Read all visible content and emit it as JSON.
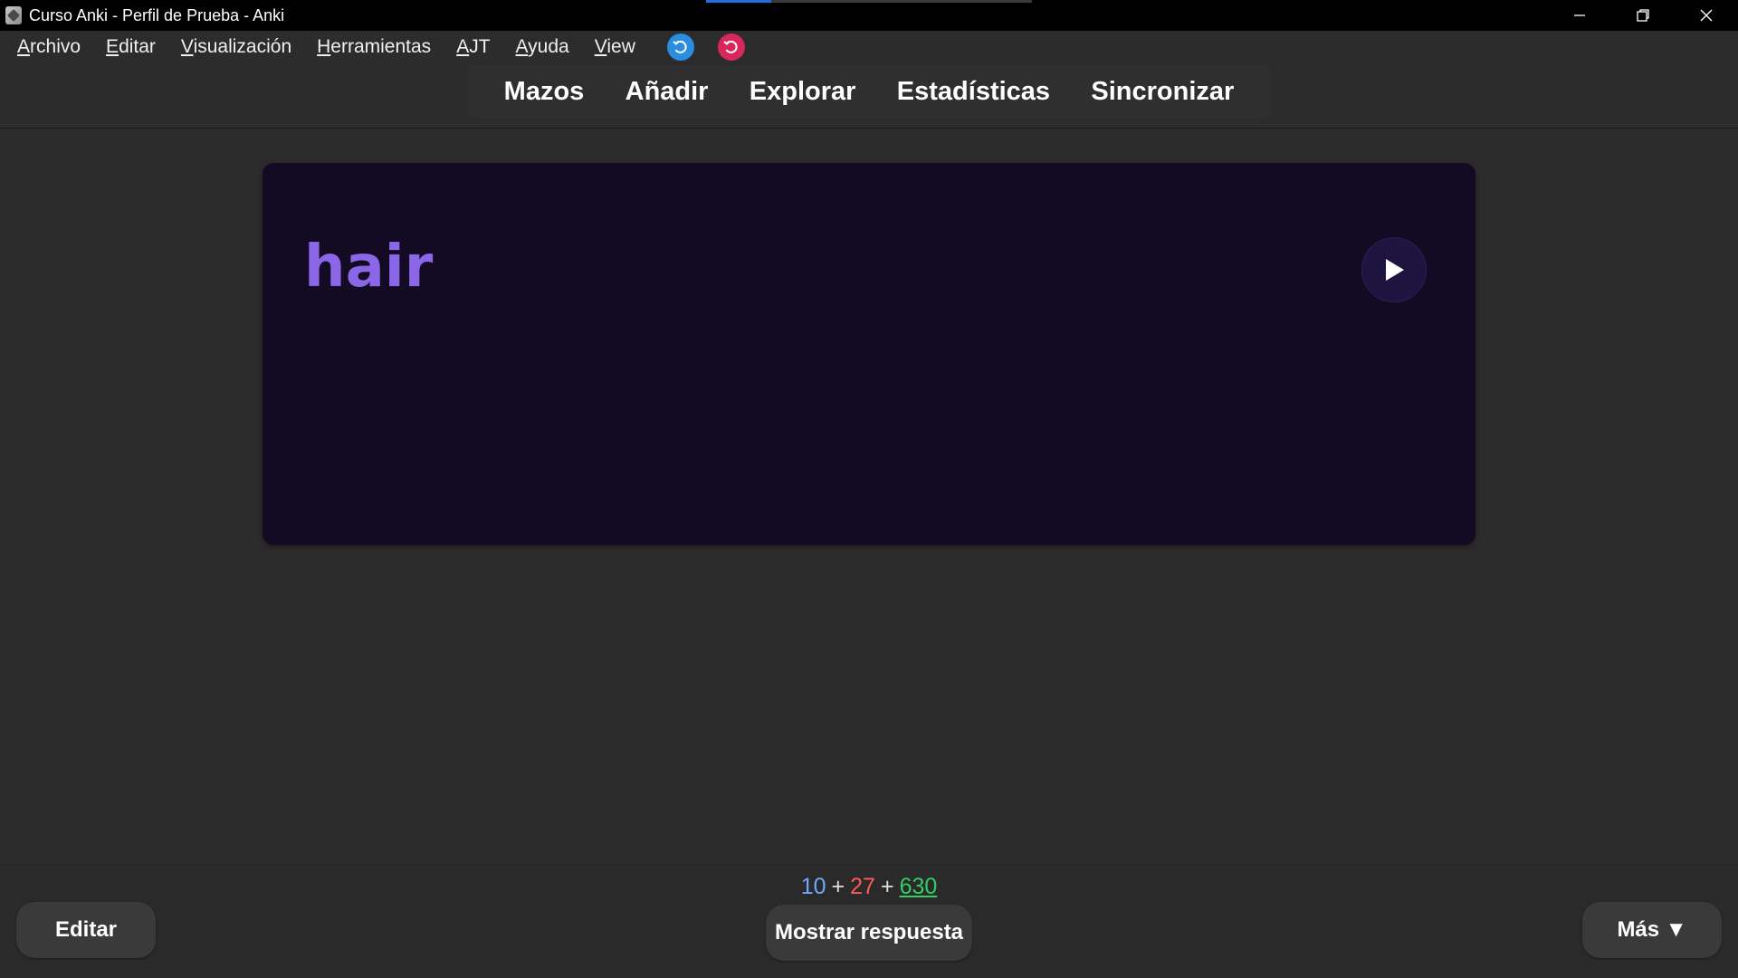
{
  "window": {
    "title": "Curso Anki - Perfil de Prueba - Anki",
    "loading_progress": 0.2
  },
  "menu": {
    "items": [
      {
        "first": "A",
        "rest": "rchivo"
      },
      {
        "first": "E",
        "rest": "ditar"
      },
      {
        "first": "V",
        "rest": "isualización"
      },
      {
        "first": "H",
        "rest": "erramientas"
      },
      {
        "first": "A",
        "rest": "JT"
      },
      {
        "first": "A",
        "rest": "yuda"
      },
      {
        "first": "V",
        "rest": "iew"
      }
    ],
    "icons": [
      "undo-blue-icon",
      "undo-red-icon"
    ]
  },
  "toolbar": {
    "links": [
      "Mazos",
      "Añadir",
      "Explorar",
      "Estadísticas",
      "Sincronizar"
    ]
  },
  "card": {
    "word": "hair",
    "play_icon": "play-icon"
  },
  "bottom": {
    "counts": {
      "new": "10",
      "plus1": "+",
      "learn": "27",
      "plus2": "+",
      "review": "630"
    },
    "edit_label": "Editar",
    "show_answer_label": "Mostrar respuesta",
    "more_label": "Más ▼"
  },
  "colors": {
    "card_background": "#130b24",
    "word_color": "#8b67e8",
    "new_count": "#6fa8ff",
    "learn_count": "#ff5a5a",
    "review_count": "#33cc66"
  }
}
